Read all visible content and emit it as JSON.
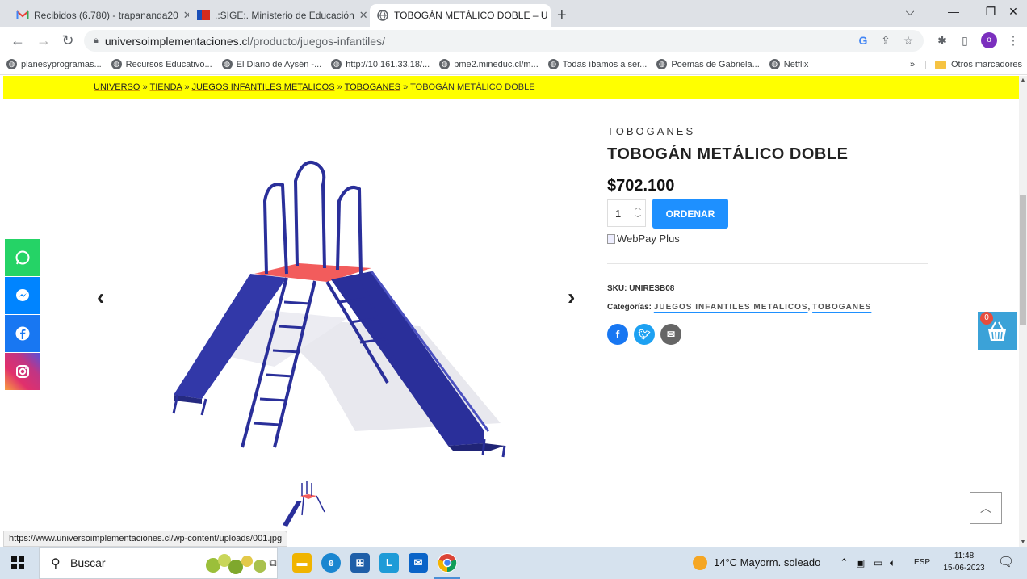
{
  "browser": {
    "tabs": [
      {
        "title": "Recibidos (6.780) - trapananda20",
        "icon": "gmail-icon"
      },
      {
        "title": ".:SIGE:. Ministerio de Educación",
        "icon": "flag-icon"
      },
      {
        "title": "TOBOGÁN METÁLICO DOBLE – U",
        "icon": "globe-icon"
      }
    ],
    "url_host": "universoimplementaciones.cl",
    "url_path": "/producto/juegos-infantiles/",
    "bookmarks": [
      "planesyprogramas...",
      "Recursos Educativo...",
      "El Diario de Aysén -...",
      "http://10.161.33.18/...",
      "pme2.mineduc.cl/m...",
      "Todas íbamos a ser...",
      "Poemas de Gabriela...",
      "Netflix"
    ],
    "bookmarks_more": "»",
    "other_bookmarks": "Otros marcadores",
    "profile_initial": "o",
    "status_url": "https://www.universoimplementaciones.cl/wp-content/uploads/001.jpg"
  },
  "breadcrumb": {
    "items": [
      "UNIVERSO",
      "TIENDA",
      "JUEGOS INFANTILES METALICOS",
      "TOBOGANES"
    ],
    "separator": "»",
    "current": "TOBOGÁN METÁLICO DOBLE"
  },
  "product": {
    "category": "TOBOGANES",
    "title": "TOBOGÁN METÁLICO DOBLE",
    "price": "$702.100",
    "quantity": "1",
    "order_label": "ORDENAR",
    "webpay_alt": "WebPay Plus",
    "sku_label": "SKU:",
    "sku_value": "UNIRESB08",
    "categories_label": "Categorías:",
    "categories": [
      "JUEGOS INFANTILES METALICOS",
      "TOBOGANES"
    ],
    "categories_sep": ","
  },
  "cart": {
    "count": "0"
  },
  "taskbar": {
    "search_placeholder": "Buscar",
    "weather": "14°C  Mayorm. soleado",
    "language": "ESP",
    "time": "11:48",
    "date": "15-06-2023"
  },
  "colors": {
    "breadcrumb_bg": "#ffff00",
    "accent": "#1e90ff",
    "slide": "#2a2f9a",
    "platform": "#f25c5c",
    "whatsapp": "#25d366",
    "messenger": "#0084ff",
    "facebook": "#1877f2"
  }
}
